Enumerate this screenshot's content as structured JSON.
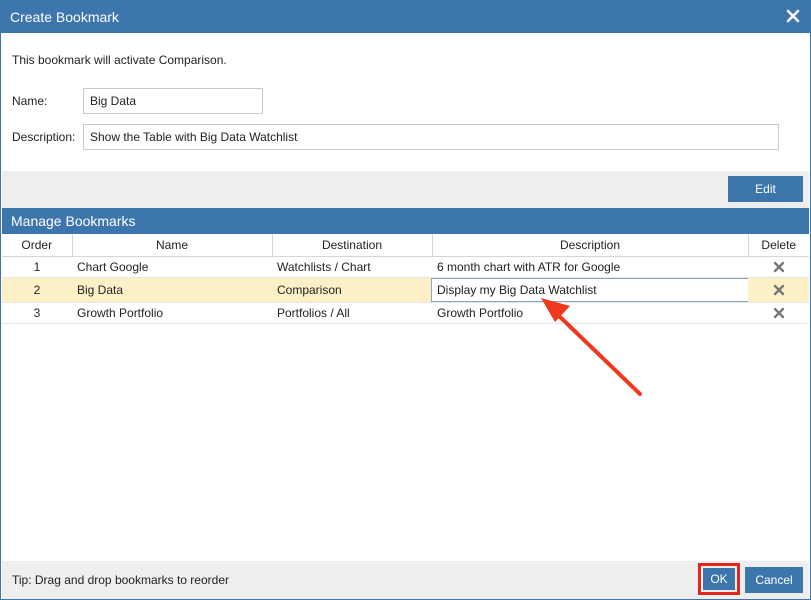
{
  "dialog": {
    "title": "Create Bookmark",
    "close_icon": "close-icon",
    "info_text": "This bookmark will activate Comparison.",
    "name_label": "Name:",
    "name_value": "Big Data",
    "description_label": "Description:",
    "description_value": "Show the Table with Big Data Watchlist",
    "edit_label": "Edit"
  },
  "manage": {
    "title": "Manage Bookmarks",
    "columns": [
      "Order",
      "Name",
      "Destination",
      "Description",
      "Delete"
    ],
    "rows": [
      {
        "order": "1",
        "name": "Chart Google",
        "destination": "Watchlists / Chart",
        "description": "6 month chart with ATR for Google",
        "delete_icon": "delete-x-icon"
      },
      {
        "order": "2",
        "name": "Big Data",
        "destination": "Comparison",
        "description": "Display my Big Data Watchlist",
        "delete_icon": "delete-x-icon",
        "selected": true,
        "editing_description": true
      },
      {
        "order": "3",
        "name": "Growth Portfolio",
        "destination": "Portfolios / All",
        "description": "Growth Portfolio",
        "delete_icon": "delete-x-icon"
      }
    ]
  },
  "footer": {
    "tip": "Tip: Drag and drop bookmarks to reorder",
    "ok_label": "OK",
    "cancel_label": "Cancel"
  },
  "colors": {
    "titlebar": "#3d75ad",
    "selected_row": "#fdf0c6",
    "highlight": "#e0281c"
  }
}
